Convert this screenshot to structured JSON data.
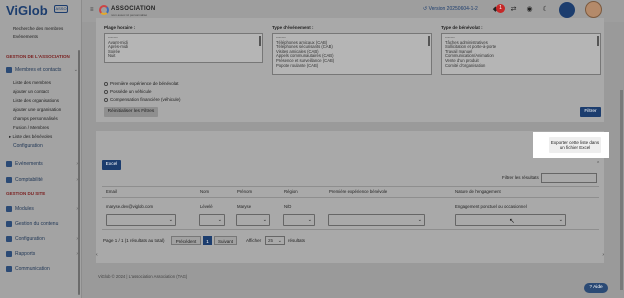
{
  "sidebar": {
    "logo_text": "ViGlob",
    "logo_badge": "ASSO",
    "top_links": [
      "Recherche des membres",
      "Evénements"
    ],
    "section_association": "GESTION DE L'ASSOCIATION",
    "members_menu": {
      "label": "Membres et contacts",
      "children": [
        "Liste des membres",
        "ajouter un contact",
        "Liste des organisations",
        "ajouter une organisation",
        "champs personnalisés",
        "Fusion / Membres"
      ]
    },
    "volunteers_item": "Liste des bénévoles",
    "configuration_item": "Configuration",
    "events_item": "Evénements",
    "accounting_item": "Comptabilité",
    "section_site": "GESTION DU SITE",
    "modules_item": "Modules",
    "content_item": "Gestion du contenu",
    "site_config_item": "Configuration",
    "reports_item": "Rapports",
    "communications_item": "Communication"
  },
  "topbar": {
    "association_title": "ASSOCIATION",
    "association_subtitle": "nom assoc ici personnalisé",
    "version": "Version 20250604-1-2",
    "notification_count": "1"
  },
  "filters": {
    "schedule_label": "Plage horaire :",
    "schedule_options": [
      "-------",
      "Avant-midi",
      "Après-midi",
      "Soirée",
      "Nuit"
    ],
    "event_type_label": "Type d'événement :",
    "event_type_options": [
      "-------",
      "Téléphones amicaux (CAB)",
      "Téléphones sécurisants (CAB)",
      "Visites amicales (CAB)",
      "Appels communautaires (CAB)",
      "Présence et surveillance (CAB)",
      "Popote roulante (CAB)"
    ],
    "volunteer_type_label": "Type de bénévolat :",
    "volunteer_type_options": [
      "-------",
      "Tâches administratives",
      "Sollicitation et porte-à-porte",
      "Travail manuel",
      "Communication/Animation",
      "Vente d'un produit",
      "Comité d'organisation"
    ],
    "checkbox_first_experience": "Première expérience de bénévolat",
    "checkbox_vehicle": "Possède un véhicule",
    "checkbox_compensation": "Compensation financière (véhicule)",
    "reset_button": "Réinitialiser les Filtres",
    "filter_button": "Filtrer"
  },
  "results": {
    "export_tooltip": "Exporter cette liste dans un fichier Excel",
    "excel_button": "Excel",
    "filter_results_label": "Filtrer les résultats",
    "columns": [
      "Email",
      "Nom",
      "Prénom",
      "Région",
      "Première expérience bénévole",
      "Nature de l'engagement"
    ],
    "rows": [
      {
        "email": "maryse.dev@viglob.com",
        "nom": "Lévelé",
        "prenom": "Maryse",
        "region": "N/D",
        "experience": "",
        "engagement": "Engagement ponctuel ou occasionnel"
      }
    ],
    "pagination_info": "Page 1 / 1 (1 résultats au total)",
    "prev_button": "Précédent",
    "current_page": "1",
    "next_button": "Suivant",
    "show_label": "Afficher",
    "per_page_value": "25",
    "results_label": "résultats"
  },
  "footer": {
    "copyright": "ViGlob © 2024 | L'association Association (TAG)"
  },
  "help_button": "Aide",
  "colors": {
    "brand_navy": "#1c3d6e",
    "notification_red": "#c62828",
    "section_red": "#7a1f1f"
  }
}
